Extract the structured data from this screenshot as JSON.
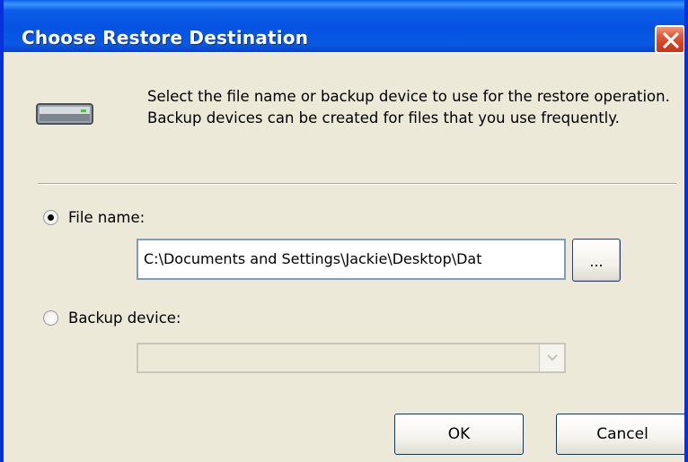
{
  "window": {
    "title": "Choose Restore Destination"
  },
  "header": {
    "icon": "drive-icon",
    "instructions": "Select the file name or backup device to use for the restore operation.  Backup devices can be created for files that you use frequently."
  },
  "options": {
    "file_name": {
      "label": "File name:",
      "selected": true,
      "value": "C:\\Documents and Settings\\Jackie\\Desktop\\Dat",
      "browse_label": "..."
    },
    "backup_device": {
      "label": "Backup device:",
      "selected": false,
      "value": "",
      "enabled": false
    }
  },
  "buttons": {
    "ok": "OK",
    "cancel": "Cancel"
  },
  "colors": {
    "titlebar": "#0553e1",
    "close_button": "#d43f1e",
    "dialog_background": "#ece9d8"
  }
}
